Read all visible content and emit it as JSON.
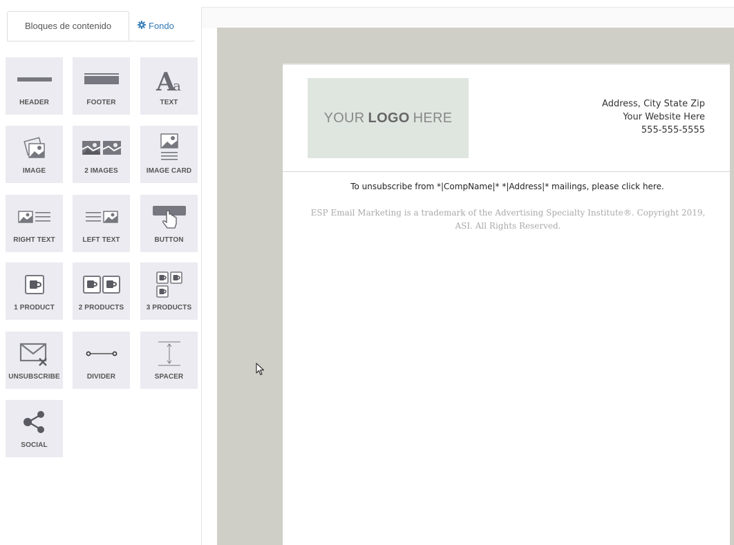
{
  "tabs": [
    {
      "label": "Bloques de contenido",
      "icon": "grid-icon",
      "active": true
    },
    {
      "label": "Fondo",
      "icon": "gear-icon",
      "active": false
    }
  ],
  "blocks": [
    {
      "label": "HEADER",
      "icon": "header-icon"
    },
    {
      "label": "FOOTER",
      "icon": "footer-icon"
    },
    {
      "label": "TEXT",
      "icon": "text-icon"
    },
    {
      "label": "IMAGE",
      "icon": "image-icon"
    },
    {
      "label": "2 IMAGES",
      "icon": "two-images-icon"
    },
    {
      "label": "IMAGE CARD",
      "icon": "image-card-icon"
    },
    {
      "label": "RIGHT TEXT",
      "icon": "right-text-icon"
    },
    {
      "label": "LEFT TEXT",
      "icon": "left-text-icon"
    },
    {
      "label": "BUTTON",
      "icon": "button-icon"
    },
    {
      "label": "1 PRODUCT",
      "icon": "one-product-icon"
    },
    {
      "label": "2 PRODUCTS",
      "icon": "two-products-icon"
    },
    {
      "label": "3 PRODUCTS",
      "icon": "three-products-icon"
    },
    {
      "label": "UNSUBSCRIBE",
      "icon": "unsubscribe-icon"
    },
    {
      "label": "DIVIDER",
      "icon": "divider-icon"
    },
    {
      "label": "SPACER",
      "icon": "spacer-icon"
    },
    {
      "label": "SOCIAL",
      "icon": "share-icon"
    }
  ],
  "email": {
    "logo": {
      "pre": "YOUR",
      "bold": "LOGO",
      "post": "HERE"
    },
    "address_lines": [
      "Address, City State Zip",
      "Your Website Here",
      "555-555-5555"
    ],
    "unsubscribe_text": "To unsubscribe from *|CompName|* *|Address|* mailings, please click here.",
    "copyright_line1": "ESP Email Marketing is a trademark of the Advertising Specialty Institute®. Copyright 2019,",
    "copyright_line2": "ASI. All Rights Reserved."
  },
  "colors": {
    "canvas_bg": "#cfcfc7",
    "block_bg": "#ebebf1",
    "logo_bg": "#dfe6df",
    "link_blue": "#337ab7"
  }
}
